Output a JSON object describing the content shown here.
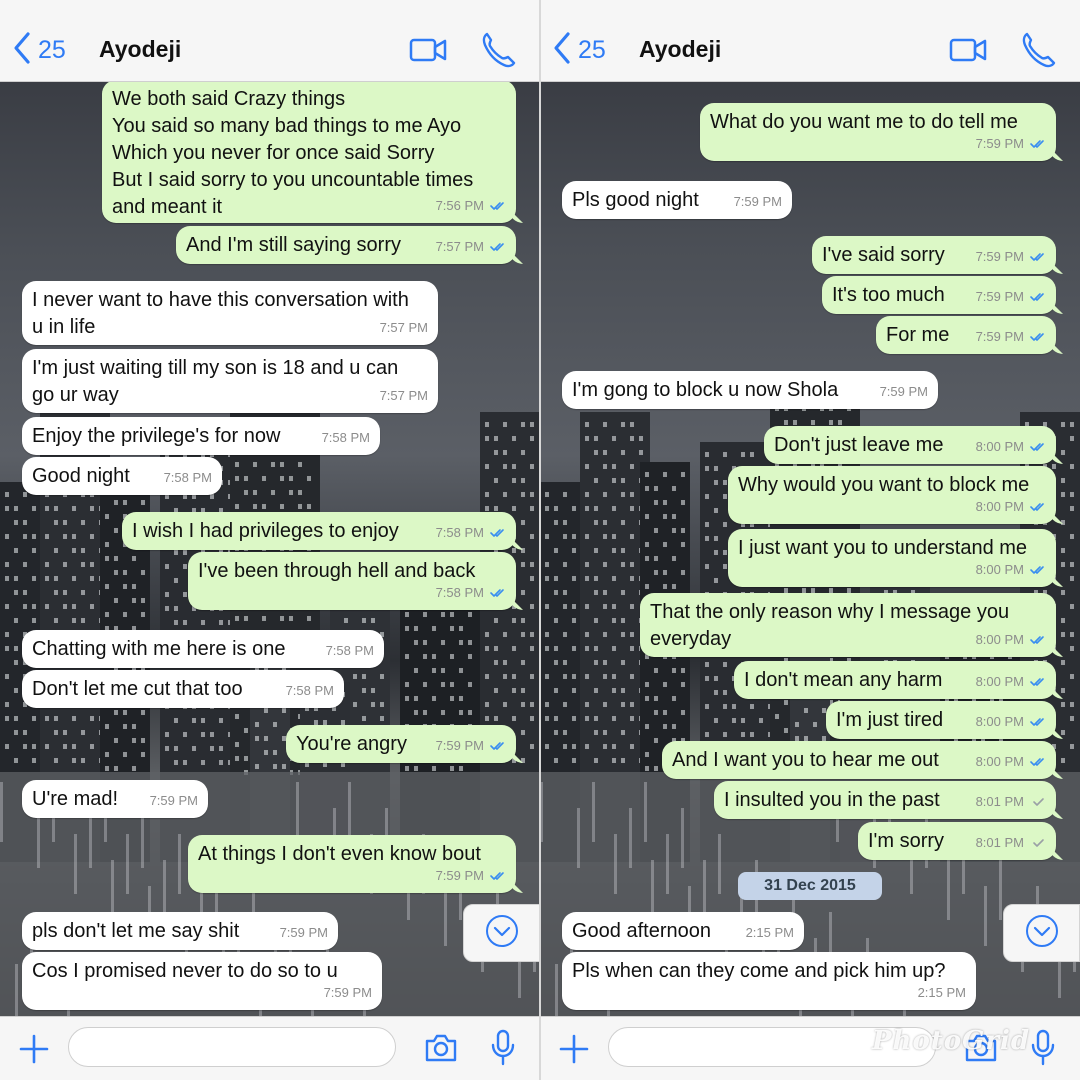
{
  "colors": {
    "accent": "#2f7bf5",
    "outgoing_bubble": "#dcf8c6",
    "incoming_bubble": "#ffffff",
    "read_ticks": "#3a8ef0"
  },
  "left": {
    "header": {
      "back_count": "25",
      "title": "Ayodeji"
    },
    "messages": [
      {
        "dir": "out",
        "text": "We both said Crazy things\nYou said so many bad things to me Ayo\nWhich you never for once said Sorry\nBut I said sorry to you uncountable times\nand meant it",
        "time": "7:56 PM",
        "status": "read"
      },
      {
        "dir": "out",
        "text": "And I'm still saying sorry",
        "time": "7:57 PM",
        "status": "read"
      },
      {
        "dir": "in",
        "text": "I never want to have this conversation with\nu in life",
        "time": "7:57 PM"
      },
      {
        "dir": "in",
        "text": "I'm just waiting till my son is 18 and u can\ngo ur way",
        "time": "7:57 PM"
      },
      {
        "dir": "in",
        "text": "Enjoy the privilege's for now",
        "time": "7:58 PM"
      },
      {
        "dir": "in",
        "text": "Good night",
        "time": "7:58 PM"
      },
      {
        "dir": "out",
        "text": "I wish I had privileges to enjoy",
        "time": "7:58 PM",
        "status": "read"
      },
      {
        "dir": "out",
        "text": "I've been through hell and back",
        "time": "7:58 PM",
        "status": "read"
      },
      {
        "dir": "in",
        "text": "Chatting with me here is one",
        "time": "7:58 PM"
      },
      {
        "dir": "in",
        "text": "Don't let me cut that too",
        "time": "7:58 PM"
      },
      {
        "dir": "out",
        "text": "You're angry",
        "time": "7:59 PM",
        "status": "read"
      },
      {
        "dir": "in",
        "text": "U're mad!",
        "time": "7:59 PM"
      },
      {
        "dir": "out",
        "text": "At things I don't even know bout",
        "time": "7:59 PM",
        "status": "read"
      },
      {
        "dir": "in",
        "text": "pls don't let me say shit",
        "time": "7:59 PM"
      },
      {
        "dir": "in",
        "text": "Cos I promised never to do so to u",
        "time": "7:59 PM"
      }
    ]
  },
  "right": {
    "header": {
      "back_count": "25",
      "title": "Ayodeji"
    },
    "date_separator": "31 Dec 2015",
    "messages": [
      {
        "dir": "out",
        "text": "What do you want me to do tell me",
        "time": "7:59 PM",
        "status": "read"
      },
      {
        "dir": "in",
        "text": "Pls good night",
        "time": "7:59 PM"
      },
      {
        "dir": "out",
        "text": "I've said sorry",
        "time": "7:59 PM",
        "status": "read"
      },
      {
        "dir": "out",
        "text": "It's too much",
        "time": "7:59 PM",
        "status": "read"
      },
      {
        "dir": "out",
        "text": "For me",
        "time": "7:59 PM",
        "status": "read"
      },
      {
        "dir": "in",
        "text": "I'm gong to block u now Shola",
        "time": "7:59 PM"
      },
      {
        "dir": "out",
        "text": "Don't just leave me",
        "time": "8:00 PM",
        "status": "read"
      },
      {
        "dir": "out",
        "text": "Why would you want to block me",
        "time": "8:00 PM",
        "status": "read"
      },
      {
        "dir": "out",
        "text": "I just want you to understand me",
        "time": "8:00 PM",
        "status": "read"
      },
      {
        "dir": "out",
        "text": "That the only reason why I message you\neveryday",
        "time": "8:00 PM",
        "status": "read"
      },
      {
        "dir": "out",
        "text": "I don't mean any harm",
        "time": "8:00 PM",
        "status": "read"
      },
      {
        "dir": "out",
        "text": "I'm just tired",
        "time": "8:00 PM",
        "status": "read"
      },
      {
        "dir": "out",
        "text": "And I want you to hear me out",
        "time": "8:00 PM",
        "status": "read"
      },
      {
        "dir": "out",
        "text": "I insulted you in the past",
        "time": "8:01 PM",
        "status": "delivered"
      },
      {
        "dir": "out",
        "text": "I'm sorry",
        "time": "8:01 PM",
        "status": "delivered"
      },
      {
        "dir": "in",
        "text": "Good afternoon",
        "time": "2:15 PM"
      },
      {
        "dir": "in",
        "text": "Pls when can they come and pick him up?",
        "time": "2:15 PM"
      }
    ]
  },
  "watermark": "PhotoGrid"
}
